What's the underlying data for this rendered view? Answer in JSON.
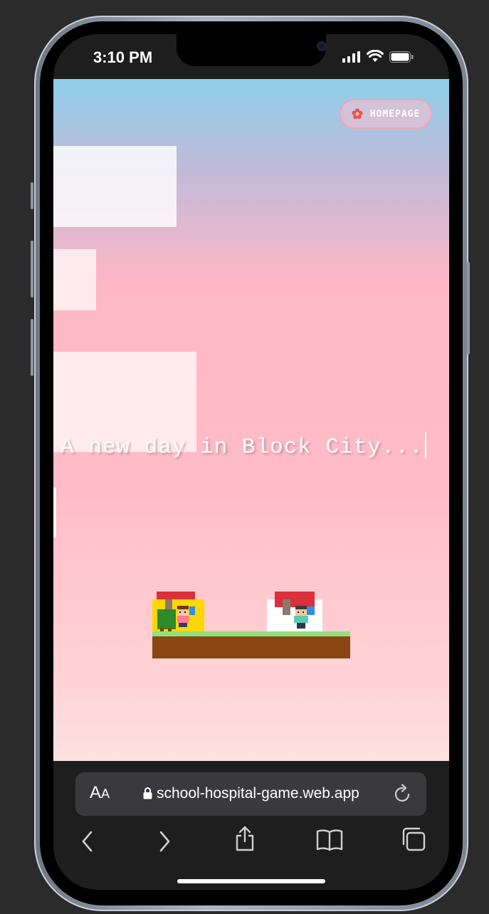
{
  "status_bar": {
    "time": "3:10 PM",
    "icons": [
      "signal-icon",
      "wifi-icon",
      "battery-icon"
    ]
  },
  "game": {
    "homepage_button": {
      "label": "HOMEPAGE",
      "icon": "flower-icon"
    },
    "intro_text": "A new day in Block City...",
    "colors": {
      "sky_top": "#8fcfea",
      "sky_mid": "#ffb7c5",
      "sky_bottom": "#ffe1e1",
      "grass": "#90e07a",
      "dirt": "#8b4513",
      "school_wall": "#ffd700",
      "hospital_wall": "#ffffff",
      "roof": "#d9303a"
    },
    "sprites": [
      "school-building",
      "tree",
      "student-character",
      "hospital-building",
      "doctor-character",
      "ground-platform"
    ]
  },
  "browser": {
    "text_size_label": "AA",
    "url": "school-hospital-game.web.app",
    "toolbar_icons": [
      "back-icon",
      "forward-icon",
      "share-icon",
      "bookmarks-icon",
      "tabs-icon"
    ]
  }
}
